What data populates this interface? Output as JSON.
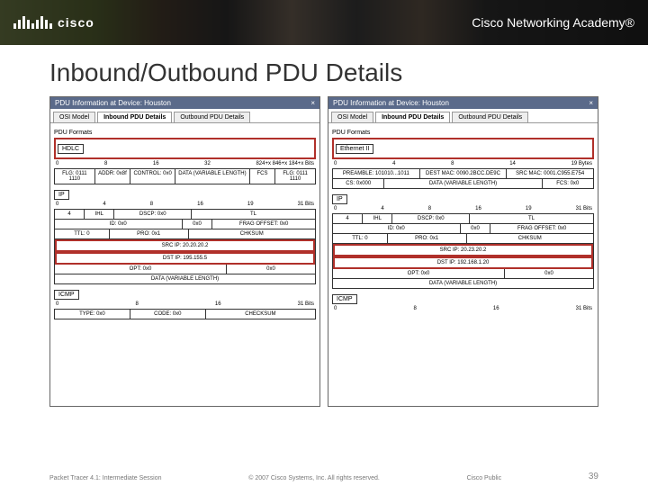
{
  "header": {
    "brand": "cisco",
    "academy_label": "Cisco Networking Academy®"
  },
  "slide": {
    "title": "Inbound/Outbound PDU Details"
  },
  "left_panel": {
    "window_title": "PDU Information at Device: Houston",
    "tabs": [
      "OSI Model",
      "Inbound PDU Details",
      "Outbound PDU Details"
    ],
    "active_tab": 1,
    "section_formats": "PDU Formats",
    "hdlc_label": "HDLC",
    "hdlc_scale": [
      "0",
      "8",
      "16",
      "32",
      "",
      "",
      "",
      "824+x 846+x 184+x Bits"
    ],
    "hdlc_row1": [
      "FLG: 0111 1110",
      "ADDR: 0x8f",
      "CONTROL: 0x0",
      "DATA (VARIABLE LENGTH)",
      "FCS",
      "FLG: 0111 1110"
    ],
    "ip_label": "IP",
    "ip_scale": [
      "0",
      "4",
      "8",
      "16",
      "19",
      "",
      "31 Bits"
    ],
    "ip_row1": [
      "4",
      "IHL",
      "DSCP: 0x0",
      "TL"
    ],
    "ip_row2": [
      "ID: 0x0",
      "0x0",
      "FRAG OFFSET: 0x0"
    ],
    "ip_row3": [
      "TTL: 0",
      "PRO: 0x1",
      "CHKSUM"
    ],
    "ip_row4": "SRC IP: 20.20.20.2",
    "ip_row5": "DST IP: 195.155.5",
    "ip_row6": [
      "OPT: 0x0",
      "0x0"
    ],
    "ip_row7": "DATA (VARIABLE LENGTH)",
    "icmp_label": "ICMP",
    "icmp_scale": [
      "0",
      "8",
      "16",
      "",
      "31 Bits"
    ],
    "icmp_row1": [
      "TYPE: 0x0",
      "CODE: 0x0",
      "CHECKSUM"
    ]
  },
  "right_panel": {
    "window_title": "PDU Information at Device: Houston",
    "tabs": [
      "OSI Model",
      "Inbound PDU Details",
      "Outbound PDU Details"
    ],
    "active_tab": 1,
    "section_formats": "PDU Formats",
    "eth_label": "Ethernet II",
    "eth_scale": [
      "0",
      "",
      "4",
      "8",
      "",
      "14",
      "",
      "19 Bytes"
    ],
    "eth_row1": [
      "PREAMBLE: 101010...1011",
      "DEST MAC: 0090.2BCC.DE9C",
      "SRC MAC: 0001.C955.E754"
    ],
    "eth_row2": [
      "CS: 0x000",
      "DATA (VARIABLE LENGTH)",
      "FCS: 0x0"
    ],
    "ip_label": "IP",
    "ip_scale": [
      "0",
      "4",
      "8",
      "16",
      "19",
      "",
      "31 Bits"
    ],
    "ip_row1": [
      "4",
      "IHL",
      "DSCP: 0x0",
      "TL"
    ],
    "ip_row2": [
      "ID: 0x0",
      "0x0",
      "FRAG OFFSET: 0x0"
    ],
    "ip_row3": [
      "TTL: 0",
      "PRO: 0x1",
      "CHKSUM"
    ],
    "ip_row4": "SRC IP: 20.23.20.2",
    "ip_row5": "DST IP: 192.168.1.20",
    "ip_row6": [
      "OPT: 0x0",
      "0x0"
    ],
    "ip_row7": "DATA (VARIABLE LENGTH)",
    "icmp_label": "ICMP",
    "icmp_scale": [
      "0",
      "8",
      "16",
      "",
      "31 Bits"
    ]
  },
  "footer": {
    "left": "Packet Tracer 4.1: Intermediate Session",
    "center": "© 2007 Cisco Systems, Inc. All rights reserved.",
    "right": "Cisco Public",
    "page": "39"
  }
}
